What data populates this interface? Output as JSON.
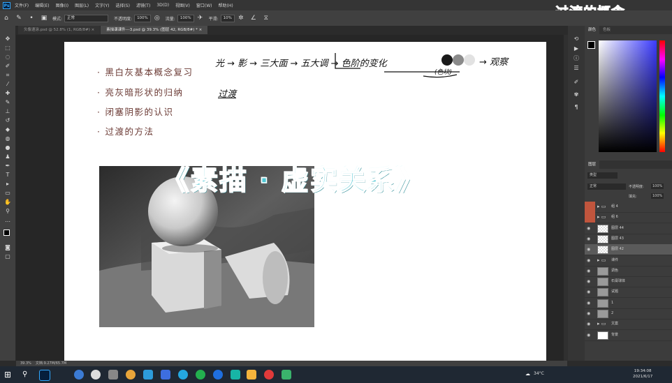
{
  "menu": {
    "app_icon": "Ps",
    "items": [
      "文件(F)",
      "编辑(E)",
      "图像(I)",
      "图层(L)",
      "文字(Y)",
      "选择(S)",
      "滤镜(T)",
      "3D(D)",
      "视图(V)",
      "窗口(W)",
      "帮助(H)"
    ]
  },
  "overlay_title": "过渡的概念",
  "options": {
    "mode_label": "模式:",
    "mode_value": "正常",
    "opacity_label": "不透明度:",
    "opacity_value": "100%",
    "flow_label": "流量:",
    "flow_value": "100%",
    "smooth_label": "平滑:",
    "smooth_value": "10%"
  },
  "tabs": [
    {
      "label": "头像速涂.psd @ 52.8% (1, RGB/8#) ×",
      "active": false
    },
    {
      "label": "素描课课件---3.psd @ 39.3% (图层 42, RGB/8#) * ×",
      "active": true
    }
  ],
  "slide": {
    "bullets": [
      "黑白灰基本概念复习",
      "亮灰暗形状的归纳",
      "闭塞阴影的认识",
      "过渡的方法"
    ],
    "handwriting_row1": "光 → 影 → 三大面 → 五大调 → 色阶的变化",
    "handwriting_note": "(色块)",
    "handwriting_end": "→ 观察",
    "handwriting_row2": "过渡",
    "big_title": "《素描 · 虚实关系》"
  },
  "status": {
    "zoom": "39.3%",
    "doc_info": "文档:9.27M/65.7M"
  },
  "right_panel": {
    "color_tabs": [
      "颜色",
      "色板"
    ],
    "layers_tab": "图层",
    "kind_label": "类型",
    "blend_value": "正常",
    "opacity_label": "不透明度:",
    "opacity_value": "100%",
    "fill_label": "填充:",
    "fill_value": "100%",
    "layers": [
      {
        "name": "组 4",
        "type": "folder",
        "marked": true
      },
      {
        "name": "组 6",
        "type": "folder",
        "marked": true
      },
      {
        "name": "图层 44",
        "type": "checker"
      },
      {
        "name": "图层 43",
        "type": "checker"
      },
      {
        "name": "图层 42",
        "type": "checker",
        "selected": true
      },
      {
        "name": "课件",
        "type": "folder"
      },
      {
        "name": "调色",
        "type": "image"
      },
      {
        "name": "石膏球体",
        "type": "image"
      },
      {
        "name": "试题",
        "type": "image"
      },
      {
        "name": "1",
        "type": "image"
      },
      {
        "name": "2",
        "type": "image"
      },
      {
        "name": "文案",
        "type": "folder"
      },
      {
        "name": "背景",
        "type": "white"
      }
    ]
  },
  "taskbar": {
    "weather": "34°C",
    "time": "19:34:08",
    "date": "2021/6/17"
  },
  "colors": {
    "accent_title": "#4fc6d3",
    "bullet_text": "#6b3a34",
    "layer_marker": "#c0553d"
  }
}
